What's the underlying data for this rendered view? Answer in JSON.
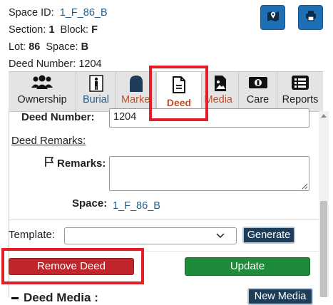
{
  "header": {
    "space_id_label": "Space ID:",
    "space_id_value": "1_F_86_B",
    "section_label": "Section:",
    "section_value": "1",
    "block_label": "Block:",
    "block_value": "F",
    "lot_label": "Lot:",
    "lot_value": "86",
    "space_label": "Space:",
    "space_value": "B",
    "deed_number_label": "Deed Number:",
    "deed_number_value": "1204",
    "map_button_icon": "map-marker-icon",
    "print_button_icon": "printer-icon"
  },
  "tabs": [
    {
      "label": "Ownership",
      "icon": "people-icon"
    },
    {
      "label": "Burial",
      "icon": "person-icon"
    },
    {
      "label": "Marke",
      "icon": "marker-icon"
    },
    {
      "label": "Deed",
      "icon": "document-icon",
      "active": true
    },
    {
      "label": "Media",
      "icon": "image-icon"
    },
    {
      "label": "Care",
      "icon": "money-icon"
    },
    {
      "label": "Reports",
      "icon": "list-icon"
    }
  ],
  "form": {
    "deed_number_label": "Deed Number:",
    "deed_number_value": "1204",
    "deed_remarks_heading": "Deed Remarks:",
    "remarks_label": "Remarks:",
    "remarks_value": "",
    "space_label": "Space:",
    "space_value": "1_F_86_B"
  },
  "template": {
    "label": "Template:",
    "selected": "",
    "generate_label": "Generate"
  },
  "actions": {
    "remove_deed_label": "Remove Deed",
    "update_label": "Update"
  },
  "media": {
    "heading": "Deed Media :",
    "new_media_label": "New Media"
  },
  "colors": {
    "icon_button_blue": "#1f6fb5",
    "remove_red": "#c0272d",
    "update_green": "#1f8a3a",
    "generate_navy": "#1e3d59",
    "active_tab_text": "#c0502a",
    "highlight_red": "#e21f26",
    "link_blue": "#1f5e8c"
  }
}
